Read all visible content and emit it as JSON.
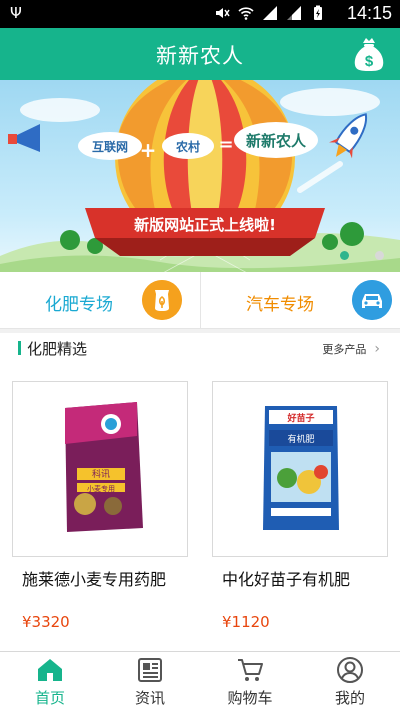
{
  "status_bar": {
    "time": "14:15"
  },
  "app_bar": {
    "title": "新新农人"
  },
  "banner": {
    "slogan_left": "互联网",
    "slogan_plus": "+",
    "slogan_mid": "农村",
    "slogan_eq": "=",
    "slogan_right": "新新农人",
    "ribbon_text": "新版网站正式上线啦!",
    "slide_count": 2,
    "active_slide": 0
  },
  "categories": [
    {
      "label": "化肥专场",
      "icon": "fertilizer-bag-icon",
      "color": "#f5a11d"
    },
    {
      "label": "汽车专场",
      "icon": "car-icon",
      "color": "#2f9de0"
    }
  ],
  "section": {
    "title": "化肥精选",
    "more_label": "更多产品"
  },
  "products": [
    {
      "name": "施莱德小麦专用药肥",
      "price": "¥3320",
      "bag_brand": "科讯",
      "bag_text": "小麦专用"
    },
    {
      "name": "中化好苗子有机肥",
      "price": "¥1120",
      "bag_brand": "好苗子",
      "bag_text": "有机肥"
    }
  ],
  "nav": [
    {
      "label": "首页",
      "icon": "home-icon",
      "active": true
    },
    {
      "label": "资讯",
      "icon": "news-icon",
      "active": false
    },
    {
      "label": "购物车",
      "icon": "cart-icon",
      "active": false
    },
    {
      "label": "我的",
      "icon": "user-icon",
      "active": false
    }
  ],
  "colors": {
    "primary": "#16b48c",
    "price": "#e8460e",
    "fertilizer_link": "#1aa9d2",
    "car_link": "#f08c00"
  }
}
